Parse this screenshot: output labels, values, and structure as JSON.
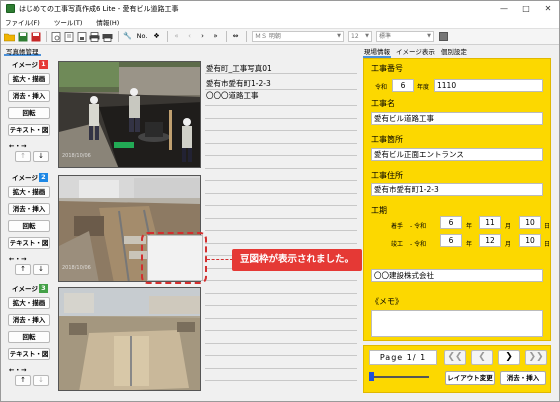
{
  "window": {
    "title": "はじめての工事写真作成6 Lite - 愛有ビル道路工事",
    "minimize_icon": "minimize-icon",
    "maximize_icon": "maximize-icon",
    "close_icon": "close-icon"
  },
  "menu": {
    "items": [
      {
        "label": "ファイル(F)"
      },
      {
        "label": "ツール(T)"
      },
      {
        "label": "情報(H)"
      }
    ]
  },
  "toolbar": {
    "font_placeholder": "ＭＳ 明朝",
    "size_placeholder": "12",
    "style_placeholder": "標準",
    "number_label": "No.",
    "icons": [
      "open-folder-icon",
      "save-icon",
      "save-as-icon",
      "print-setup-icon",
      "page-icon",
      "page-print-icon",
      "print-icon",
      "print-all-icon",
      "tools-icon",
      "number-icon",
      "hierarchy-icon",
      "first-icon",
      "prev-icon",
      "next-icon",
      "last-icon",
      "swap-icon"
    ]
  },
  "left_panel": {
    "tab_label": "写真帳管理",
    "groups": [
      {
        "image_label": "イメージ",
        "number": "1",
        "btn_enlarge": "拡大・描画",
        "btn_delete": "消去・挿入",
        "btn_rotate": "回転",
        "btn_text": "テキスト・図",
        "arrows": "←・→"
      },
      {
        "image_label": "イメージ",
        "number": "2",
        "btn_enlarge": "拡大・描画",
        "btn_delete": "消去・挿入",
        "btn_rotate": "回転",
        "btn_text": "テキスト・図",
        "arrows": "←・→"
      },
      {
        "image_label": "イメージ",
        "number": "3",
        "btn_enlarge": "拡大・描画",
        "btn_delete": "消去・挿入",
        "btn_rotate": "回転",
        "btn_text": "テキスト・図",
        "arrows": "←・→"
      }
    ]
  },
  "photos": [
    {
      "stamp": "2018/10/06"
    },
    {
      "stamp": "2018/10/06"
    },
    {
      "stamp": ""
    }
  ],
  "text_column": {
    "lines": [
      "愛有町_工事写真01",
      "愛有市愛有町1-2-3",
      "〇〇〇道路工事"
    ]
  },
  "right_tabs": [
    "現場情報",
    "イメージ表示",
    "個別設定"
  ],
  "info": {
    "construction_number_label": "工事番号",
    "era_label": "令和",
    "year_value": "6",
    "year_unit": "年度",
    "number_value": "1110",
    "name_label": "工事名",
    "name_value": "愛有ビル道路工事",
    "place_label": "工事箇所",
    "place_value": "愛有ビル正面エントランス",
    "address_label": "工事住所",
    "address_value": "愛有市愛有町1-2-3",
    "period_label": "工期",
    "start_label": "着手",
    "end_label": "竣工",
    "era_prefix": "- 令和",
    "start_year": "6",
    "start_month": "11",
    "start_day": "10",
    "end_year": "6",
    "end_month": "12",
    "end_day": "10",
    "year_char": "年",
    "month_char": "月",
    "day_char": "日",
    "company_value": "〇〇建設株式会社",
    "memo_label": "《メモ》",
    "memo_value": ""
  },
  "nav": {
    "page_text": "Page 1/ 1",
    "layout_button": "レイアウト変更",
    "delete_insert_button": "消去・挿入"
  },
  "annotation": {
    "callout_text": "豆図枠が表示されました。"
  }
}
